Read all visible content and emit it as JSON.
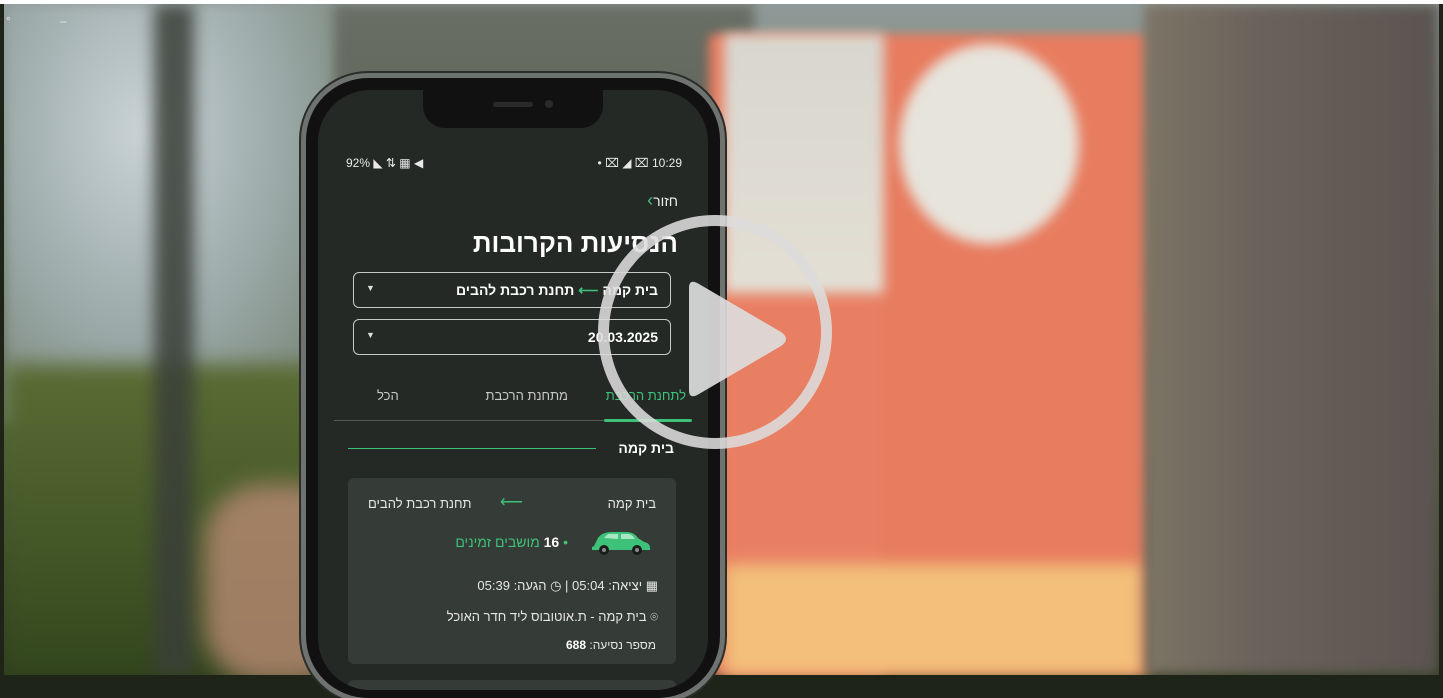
{
  "video": {
    "play_label": "Play"
  },
  "status_bar": {
    "left": "92% ◣ ⇅ ▦ ◀",
    "right": "• ⌧ ◢ ⌧ 10:29"
  },
  "app": {
    "back_label": "חזור",
    "title": "הנסיעות הקרובות",
    "route_select": {
      "from": "בית קמה",
      "to": "תחנת רכבת להבים"
    },
    "date_select": {
      "value": "20.03.2025"
    },
    "tabs": [
      {
        "label": "לתחנת הרכבת",
        "active": true
      },
      {
        "label": "מתחנת הרכבת",
        "active": false
      },
      {
        "label": "הכל",
        "active": false
      }
    ],
    "group_label": "בית קמה",
    "trip": {
      "from": "בית קמה",
      "to": "תחנת רכבת להבים",
      "seats_count": "16",
      "seats_label": "מושבים זמינים",
      "depart_label": "יציאה:",
      "depart_time": "05:04",
      "arrive_label": "הגעה:",
      "arrive_time": "05:39",
      "stop": "בית קמה - ת.אוטובוס ליד חדר האוכל",
      "trip_number_label": "מספר נסיעה:",
      "trip_number": "688"
    }
  },
  "colors": {
    "accent": "#3ec27a",
    "app_bg": "#242925",
    "card_bg": "#353b36",
    "sign": "#e87c5f"
  }
}
